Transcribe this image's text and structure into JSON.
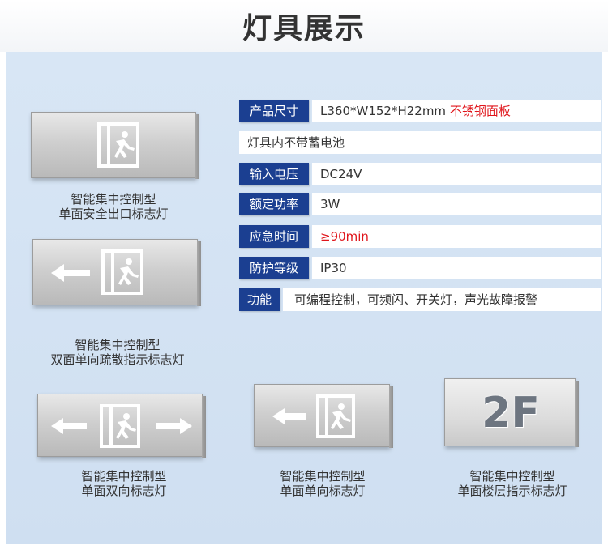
{
  "header": {
    "title": "灯具展示"
  },
  "colors": {
    "label_bg": "#1b3f91",
    "highlight": "#e0151b",
    "panel": "#d5e4f4"
  },
  "specs": [
    {
      "label": "产品尺寸",
      "value": "L360*W152*H22mm",
      "note": "不锈钢面板"
    },
    {
      "label": "",
      "value": "灯具内不带蓄电池"
    },
    {
      "label": "输入电压",
      "value": "DC24V"
    },
    {
      "label": "额定功率",
      "value": "3W"
    },
    {
      "label": "应急时间",
      "value": "≥90min"
    },
    {
      "label": "防护等级",
      "value": "IP30"
    },
    {
      "label": "功能",
      "value": "可编程控制，可频闪、开关灯，声光故障报警"
    }
  ],
  "products": [
    {
      "line1": "智能集中控制型",
      "line2": "单面安全出口标志灯",
      "icon": "exit-door-icon"
    },
    {
      "line1": "智能集中控制型",
      "line2": "双面单向疏散指示标志灯",
      "icon": "left-arrow-exit-icon"
    },
    {
      "line1": "智能集中控制型",
      "line2": "单面双向标志灯",
      "icon": "bidirectional-exit-icon"
    },
    {
      "line1": "智能集中控制型",
      "line2": "单面单向标志灯",
      "icon": "left-arrow-exit-icon"
    },
    {
      "line1": "智能集中控制型",
      "line2": "单面楼层指示标志灯",
      "floor_text": "2F"
    }
  ]
}
